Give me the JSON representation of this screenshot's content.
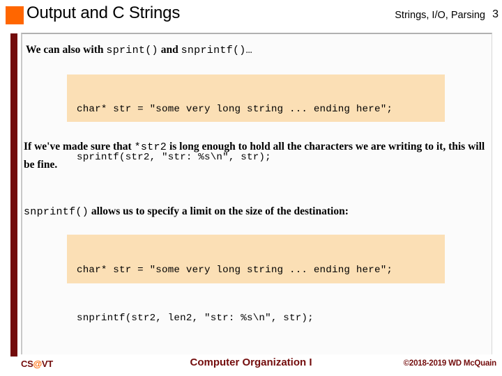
{
  "header": {
    "title": "Output and C Strings",
    "topic": "Strings, I/O, Parsing",
    "slide_number": "3",
    "bullet_color": "#ff6600"
  },
  "accents": {
    "maroon": "#730c0c",
    "orange": "#ff6600",
    "code_background": "#fbdfb5",
    "panel_border": "#b0b0b0"
  },
  "body": {
    "para_1_pre": "We can also with ",
    "para_1_code_a": "sprint()",
    "para_1_mid": " and ",
    "para_1_code_b": "snprintf()",
    "para_1_post": "…",
    "code_1_line_1": "char* str = \"some very long string ... ending here\";",
    "code_1_line_2": "sprintf(str2, \"str: %s\\n\", str);",
    "para_2_pre": "If we've made sure that ",
    "para_2_code": "*str2",
    "para_2_post": " is long enough to hold all the characters we are writing to it, this will be fine.",
    "para_3_code": "snprintf()",
    "para_3_post": " allows us to specify a limit on the size of the destination:",
    "code_2_line_1": "char* str = \"some very long string ... ending here\";",
    "code_2_line_2": "snprintf(str2, len2, \"str: %s\\n\", str);"
  },
  "footer": {
    "logo_pre": "CS",
    "logo_at": "@",
    "logo_post": "VT",
    "center": "Computer Organization I",
    "copyright": "©2018-2019 WD McQuain"
  }
}
